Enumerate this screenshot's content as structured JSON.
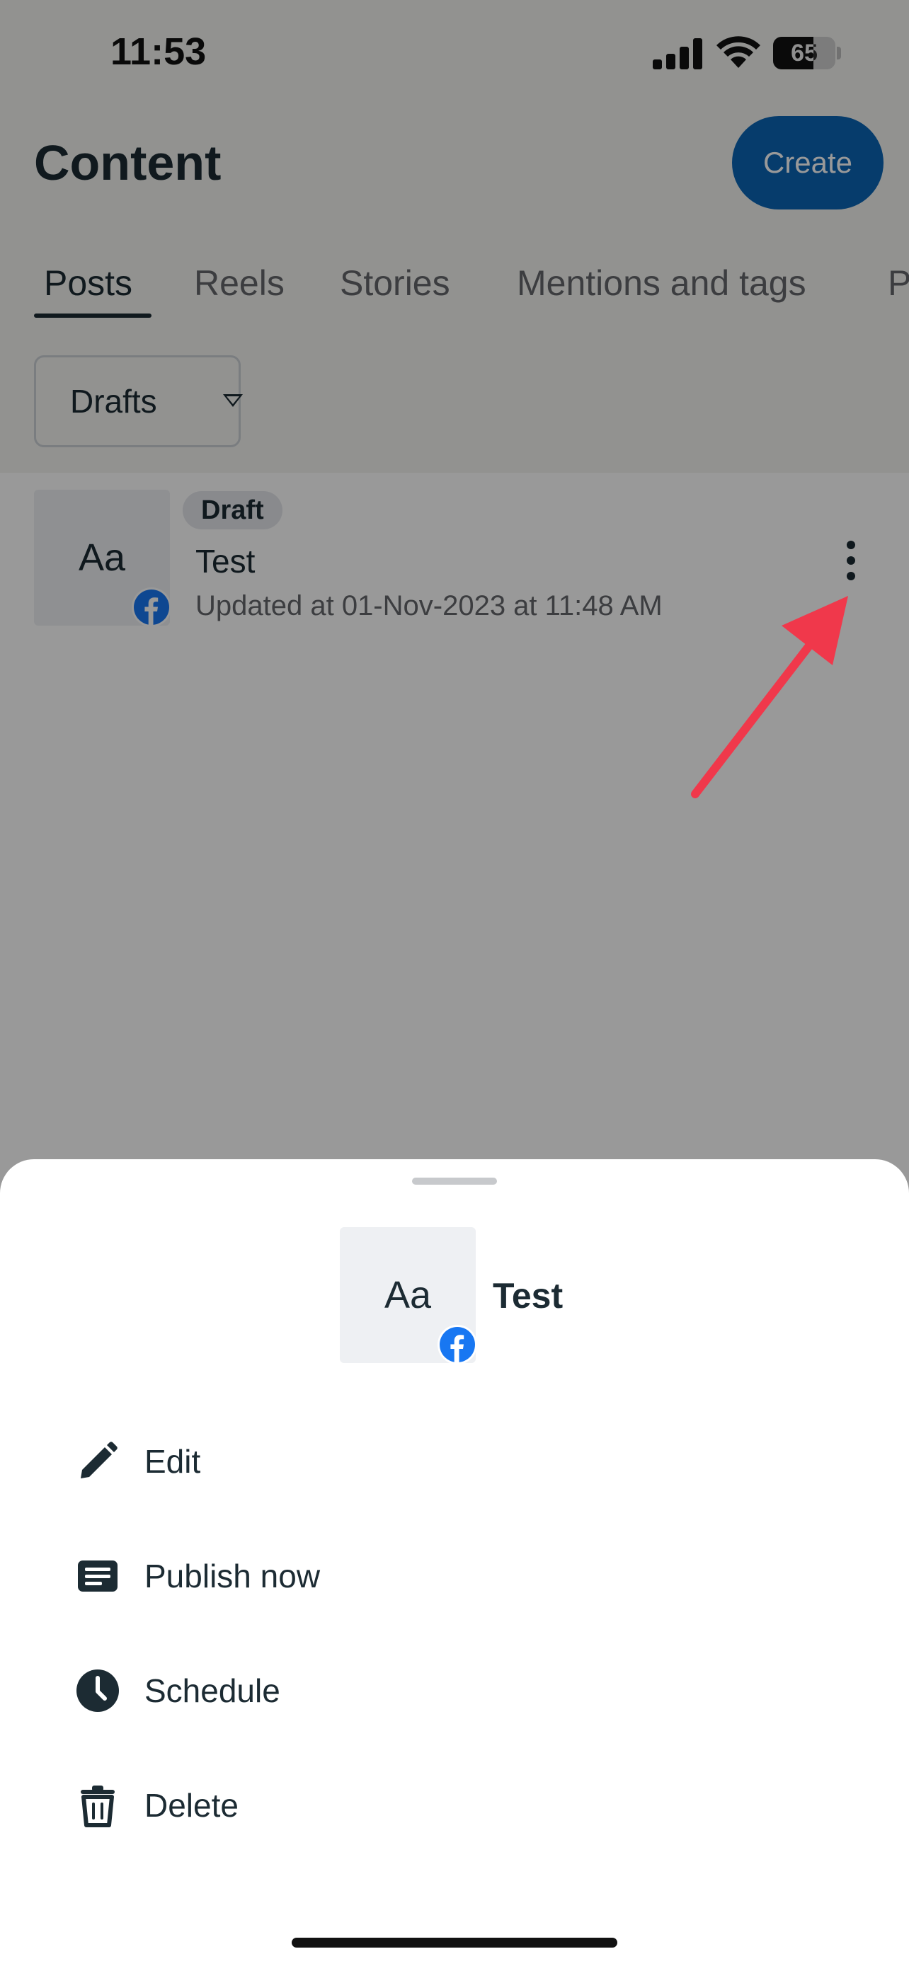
{
  "status_bar": {
    "time": "11:53",
    "battery": "65"
  },
  "header": {
    "title": "Content",
    "create_label": "Create"
  },
  "tabs": [
    {
      "label": "Posts",
      "active": true
    },
    {
      "label": "Reels",
      "active": false
    },
    {
      "label": "Stories",
      "active": false
    },
    {
      "label": "Mentions and tags",
      "active": false
    },
    {
      "label": "P",
      "active": false
    }
  ],
  "filter": {
    "selected": "Drafts"
  },
  "post": {
    "thumb_text": "Aa",
    "status_badge": "Draft",
    "title": "Test",
    "meta": "Updated at 01-Nov-2023 at 11:48 AM"
  },
  "sheet": {
    "thumb_text": "Aa",
    "title": "Test",
    "actions": [
      {
        "label": "Edit",
        "icon": "pencil-icon"
      },
      {
        "label": "Publish now",
        "icon": "document-icon"
      },
      {
        "label": "Schedule",
        "icon": "clock-icon"
      },
      {
        "label": "Delete",
        "icon": "trash-icon"
      }
    ]
  },
  "colors": {
    "accent": "#0a64b4",
    "facebook": "#1877f2",
    "text": "#1c2b33",
    "annotation_arrow": "#f0384b"
  }
}
